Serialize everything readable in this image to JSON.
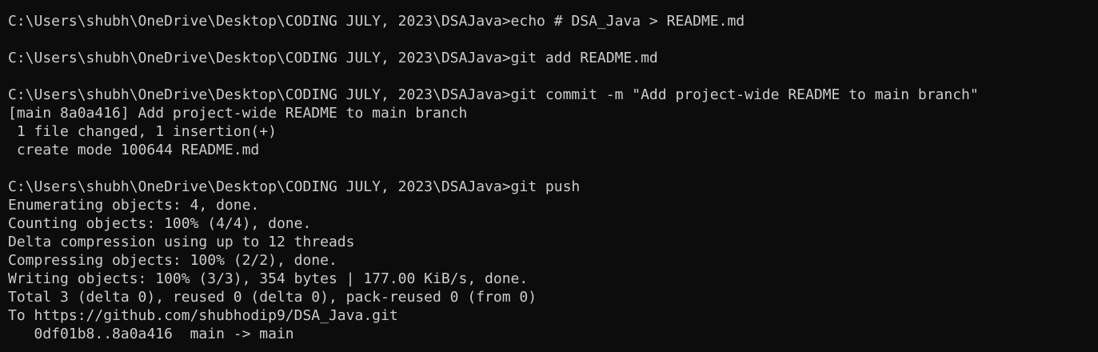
{
  "terminal": {
    "lines": [
      "C:\\Users\\shubh\\OneDrive\\Desktop\\CODING JULY, 2023\\DSAJava>echo # DSA_Java > README.md",
      "",
      "C:\\Users\\shubh\\OneDrive\\Desktop\\CODING JULY, 2023\\DSAJava>git add README.md",
      "",
      "C:\\Users\\shubh\\OneDrive\\Desktop\\CODING JULY, 2023\\DSAJava>git commit -m \"Add project-wide README to main branch\"",
      "[main 8a0a416] Add project-wide README to main branch",
      " 1 file changed, 1 insertion(+)",
      " create mode 100644 README.md",
      "",
      "C:\\Users\\shubh\\OneDrive\\Desktop\\CODING JULY, 2023\\DSAJava>git push",
      "Enumerating objects: 4, done.",
      "Counting objects: 100% (4/4), done.",
      "Delta compression using up to 12 threads",
      "Compressing objects: 100% (2/2), done.",
      "Writing objects: 100% (3/3), 354 bytes | 177.00 KiB/s, done.",
      "Total 3 (delta 0), reused 0 (delta 0), pack-reused 0 (from 0)",
      "To https://github.com/shubhodip9/DSA_Java.git",
      "   0df01b8..8a0a416  main -> main"
    ],
    "text_color": "#cccccc",
    "background_color": "#0c0c0c"
  }
}
